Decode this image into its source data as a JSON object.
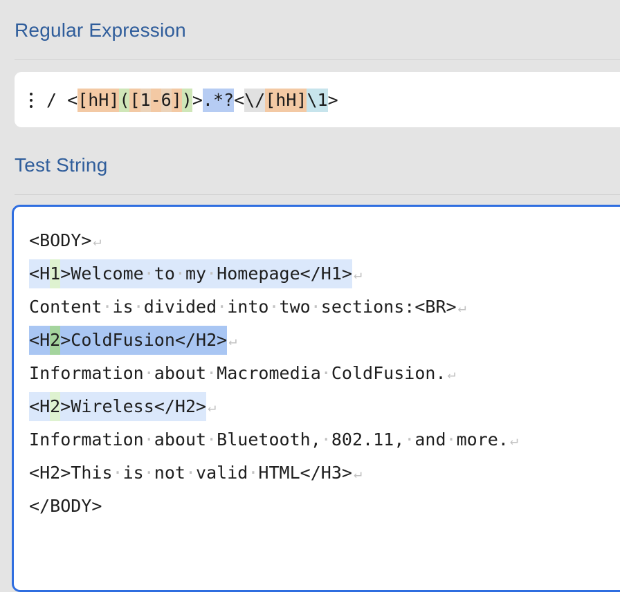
{
  "regex_section": {
    "title": "Regular Expression"
  },
  "regex": {
    "delimiter": "/",
    "tokens": [
      {
        "text": "<",
        "type": "plain"
      },
      {
        "text": "[hH]",
        "type": "class"
      },
      {
        "text": "(",
        "type": "group"
      },
      {
        "text": "[",
        "type": "class"
      },
      {
        "text": "1",
        "type": "classin"
      },
      {
        "text": "-",
        "type": "class"
      },
      {
        "text": "6",
        "type": "classin"
      },
      {
        "text": "]",
        "type": "class"
      },
      {
        "text": ")",
        "type": "group"
      },
      {
        "text": ">",
        "type": "plain"
      },
      {
        "text": ".*?",
        "type": "dot"
      },
      {
        "text": "<",
        "type": "plain"
      },
      {
        "text": "\\/",
        "type": "esc"
      },
      {
        "text": "[hH]",
        "type": "class"
      },
      {
        "text": "\\1",
        "type": "back"
      },
      {
        "text": ">",
        "type": "plain"
      }
    ]
  },
  "test_section": {
    "title": "Test String"
  },
  "test_lines": [
    {
      "segments": [
        {
          "text": "<BODY>",
          "hl": "none"
        }
      ],
      "newline": true
    },
    {
      "segments": [
        {
          "text": "<H",
          "hl": "m-light"
        },
        {
          "text": "1",
          "hl": "g-light"
        },
        {
          "text": ">Welcome·to·my·Homepage</H1>",
          "hl": "m-light"
        }
      ],
      "newline": true
    },
    {
      "segments": [
        {
          "text": "Content·is·divided·into·two·sections:<BR>",
          "hl": "none"
        }
      ],
      "newline": true
    },
    {
      "segments": [
        {
          "text": "<H",
          "hl": "m-strong"
        },
        {
          "text": "2",
          "hl": "g-strong"
        },
        {
          "text": ">ColdFusion</H2>",
          "hl": "m-strong"
        }
      ],
      "newline": true
    },
    {
      "segments": [
        {
          "text": "Information·about·Macromedia·ColdFusion.",
          "hl": "none"
        }
      ],
      "newline": true
    },
    {
      "segments": [
        {
          "text": "<H",
          "hl": "m-light"
        },
        {
          "text": "2",
          "hl": "g-light"
        },
        {
          "text": ">Wireless</H2>",
          "hl": "m-light"
        }
      ],
      "newline": true
    },
    {
      "segments": [
        {
          "text": "Information·about·Bluetooth,·802.11,·and·more.",
          "hl": "none"
        }
      ],
      "newline": true
    },
    {
      "segments": [
        {
          "text": "<H2>This·is·not·valid·HTML</H3>",
          "hl": "none"
        }
      ],
      "newline": true
    },
    {
      "segments": [
        {
          "text": "</BODY>",
          "hl": "none"
        }
      ],
      "newline": false
    }
  ],
  "newline_glyph": "↵",
  "colors": {
    "title": "#2f5d9b",
    "focus_border": "#2f6ee0",
    "match_light": "#dbe8fb",
    "match_strong": "#a9c6f3",
    "group_light": "#def2d0",
    "group_strong": "#a4d49d"
  },
  "icons": {
    "regex_menu": "vertical-ellipsis-icon"
  }
}
